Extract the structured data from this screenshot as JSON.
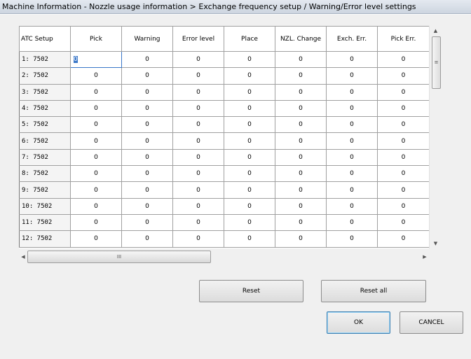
{
  "window": {
    "title": "Machine Information - Nozzle usage information > Exchange frequency setup / Warning/Error level settings"
  },
  "grid": {
    "columns": [
      "ATC Setup",
      "Pick",
      "Warning",
      "Error level",
      "Place",
      "NZL. Change",
      "Exch. Err.",
      "Pick Err."
    ],
    "rows": [
      {
        "label": "1:  7502",
        "values": [
          "0",
          "0",
          "0",
          "0",
          "0",
          "0",
          "0"
        ]
      },
      {
        "label": "2:  7502",
        "values": [
          "0",
          "0",
          "0",
          "0",
          "0",
          "0",
          "0"
        ]
      },
      {
        "label": "3:  7502",
        "values": [
          "0",
          "0",
          "0",
          "0",
          "0",
          "0",
          "0"
        ]
      },
      {
        "label": "4:  7502",
        "values": [
          "0",
          "0",
          "0",
          "0",
          "0",
          "0",
          "0"
        ]
      },
      {
        "label": "5:  7502",
        "values": [
          "0",
          "0",
          "0",
          "0",
          "0",
          "0",
          "0"
        ]
      },
      {
        "label": "6:  7502",
        "values": [
          "0",
          "0",
          "0",
          "0",
          "0",
          "0",
          "0"
        ]
      },
      {
        "label": "7:  7502",
        "values": [
          "0",
          "0",
          "0",
          "0",
          "0",
          "0",
          "0"
        ]
      },
      {
        "label": "8:  7502",
        "values": [
          "0",
          "0",
          "0",
          "0",
          "0",
          "0",
          "0"
        ]
      },
      {
        "label": "9:  7502",
        "values": [
          "0",
          "0",
          "0",
          "0",
          "0",
          "0",
          "0"
        ]
      },
      {
        "label": "10:  7502",
        "values": [
          "0",
          "0",
          "0",
          "0",
          "0",
          "0",
          "0"
        ]
      },
      {
        "label": "11:  7502",
        "values": [
          "0",
          "0",
          "0",
          "0",
          "0",
          "0",
          "0"
        ]
      },
      {
        "label": "12:  7502",
        "values": [
          "0",
          "0",
          "0",
          "0",
          "0",
          "0",
          "0"
        ]
      }
    ]
  },
  "scroll": {
    "up_icon": "scroll-up-arrow",
    "down_icon": "scroll-down-arrow",
    "left_icon": "scroll-left-arrow",
    "right_icon": "scroll-right-arrow",
    "grip_vertical": "≡",
    "grip_horizontal": "III"
  },
  "buttons": {
    "reset": "Reset",
    "reset_all": "Reset all",
    "ok": "OK",
    "cancel": "CANCEL"
  },
  "colors": {
    "selection": "#3a77c8",
    "default_button_border": "#3c7fb1"
  }
}
